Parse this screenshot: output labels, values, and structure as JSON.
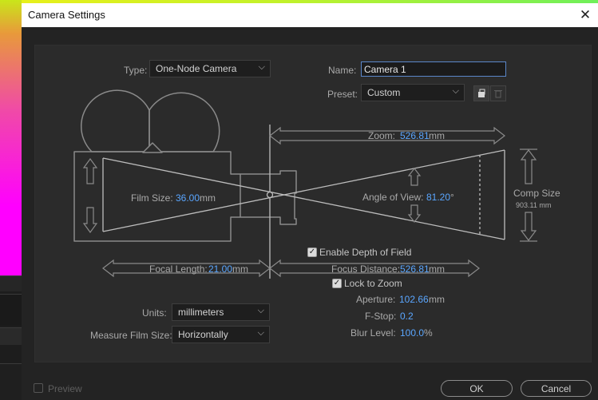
{
  "dialog": {
    "title": "Camera Settings",
    "close_glyph": "✕"
  },
  "type": {
    "label": "Type:",
    "value": "One-Node Camera"
  },
  "name": {
    "label": "Name:",
    "value": "Camera 1"
  },
  "preset": {
    "label": "Preset:",
    "value": "Custom"
  },
  "zoom": {
    "label": "Zoom:",
    "value": "526.81",
    "unit": "mm"
  },
  "film_size": {
    "label": "Film Size:",
    "value": "36.00",
    "unit": "mm"
  },
  "angle_of_view": {
    "label": "Angle of View:",
    "value": "81.20",
    "unit": "°"
  },
  "comp_size": {
    "label": "Comp Size",
    "value": "903.11 mm"
  },
  "focal_length": {
    "label": "Focal Length:",
    "value": "21.00",
    "unit": "mm"
  },
  "depth_of_field": {
    "label": "Enable Depth of Field",
    "checked": true
  },
  "focus_distance": {
    "label": "Focus Distance:",
    "value": "526.81",
    "unit": "mm"
  },
  "lock_to_zoom": {
    "label": "Lock to Zoom",
    "checked": true
  },
  "aperture": {
    "label": "Aperture:",
    "value": "102.66",
    "unit": "mm"
  },
  "fstop": {
    "label": "F-Stop:",
    "value": "0.2"
  },
  "blur_level": {
    "label": "Blur Level:",
    "value": "100.0",
    "unit": "%"
  },
  "units": {
    "label": "Units:",
    "value": "millimeters"
  },
  "measure_film_size": {
    "label": "Measure Film Size:",
    "value": "Horizontally"
  },
  "preview": {
    "label": "Preview",
    "checked": false
  },
  "buttons": {
    "ok": "OK",
    "cancel": "Cancel"
  },
  "icons": {
    "new_preset": "save-preset-icon",
    "delete_preset": "trash-icon",
    "dropdown": "chevron-down-icon"
  },
  "colors": {
    "accent_value": "#5aa6ff",
    "selection": "#3b73d6",
    "panel": "#2b2b2b"
  }
}
